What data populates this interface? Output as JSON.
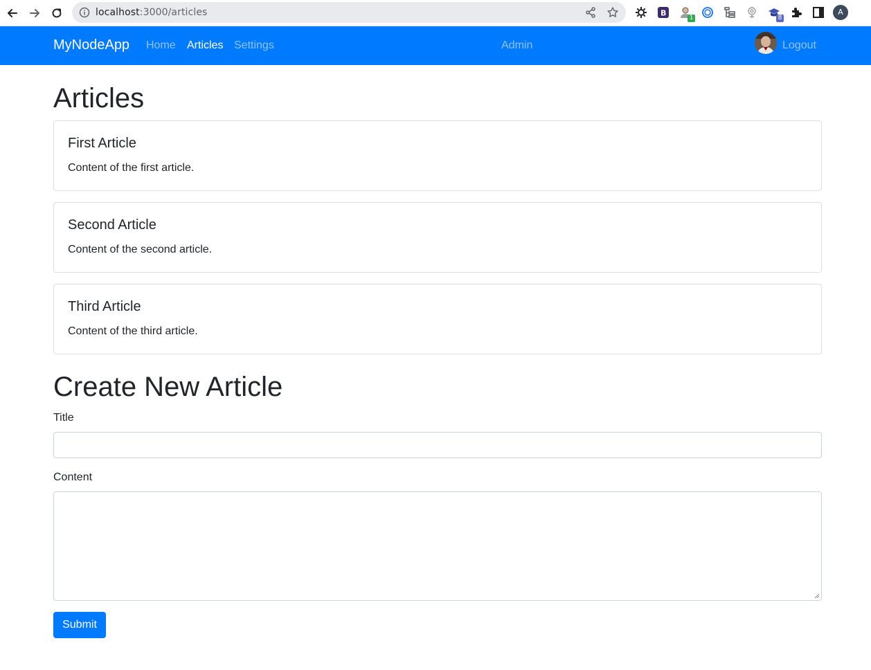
{
  "browser": {
    "url_host": "localhost",
    "url_rest": ":3000/articles",
    "profile_initial": "A",
    "extensions": [
      {
        "icon": "sun-extension-icon"
      },
      {
        "icon": "purple-b-extension-icon"
      },
      {
        "icon": "person-extension-icon",
        "badge": "1",
        "badge_color": "#34a853"
      },
      {
        "icon": "circle-extension-icon"
      },
      {
        "icon": "tree-extension-icon"
      },
      {
        "icon": "eye-extension-icon"
      },
      {
        "icon": "graduation-cap-extension-icon",
        "badge": "8",
        "badge_color": "#5c6bc0"
      },
      {
        "icon": "puzzle-icon"
      },
      {
        "icon": "sidepanel-icon"
      }
    ]
  },
  "navbar": {
    "brand": "MyNodeApp",
    "links": {
      "home": "Home",
      "articles": "Articles",
      "settings": "Settings",
      "admin": "Admin",
      "logout": "Logout"
    },
    "active": "articles",
    "color": "#007bff"
  },
  "page": {
    "title": "Articles",
    "articles": [
      {
        "title": "First Article",
        "content": "Content of the first article."
      },
      {
        "title": "Second Article",
        "content": "Content of the second article."
      },
      {
        "title": "Third Article",
        "content": "Content of the third article."
      }
    ]
  },
  "form": {
    "heading": "Create New Article",
    "title_label": "Title",
    "title_value": "",
    "content_label": "Content",
    "content_value": "",
    "submit_label": "Submit"
  }
}
